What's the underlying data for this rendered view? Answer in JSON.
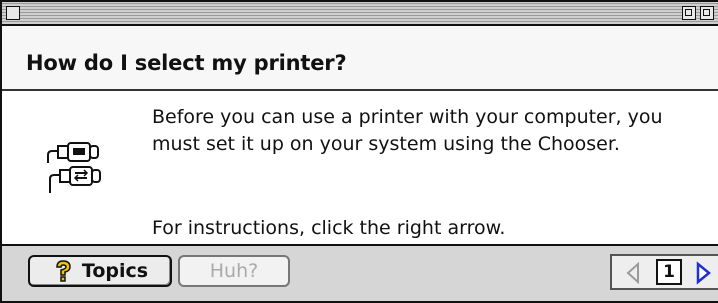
{
  "window": {
    "title": ""
  },
  "heading": "How do I select my printer?",
  "body": {
    "paragraph_1": "Before you can use a printer with your computer, you must set it up on your system using the Chooser.",
    "paragraph_2": "For instructions, click the right arrow.",
    "icon": "printer-connection-icon"
  },
  "footer": {
    "topics_label": "Topics",
    "topics_icon": "question-mark-icon",
    "huh_label": "Huh?",
    "huh_enabled": false,
    "page_number": "1",
    "prev_enabled": false,
    "next_enabled": true
  },
  "colors": {
    "question_mark": "#f2c200",
    "next_arrow": "#1f2fd1",
    "disabled_text": "#aaaaaa"
  }
}
